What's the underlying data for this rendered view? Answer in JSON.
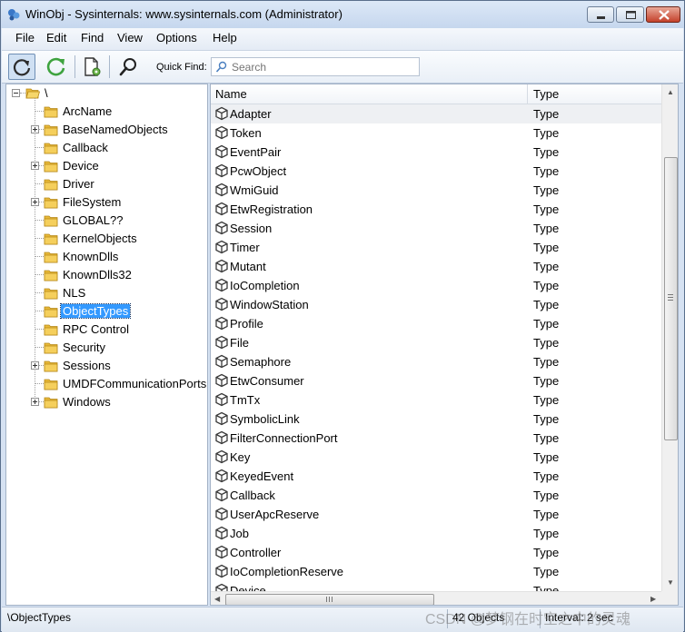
{
  "window": {
    "title": "WinObj - Sysinternals: www.sysinternals.com (Administrator)"
  },
  "menu": [
    "File",
    "Edit",
    "Find",
    "View",
    "Options",
    "Help"
  ],
  "toolbar": {
    "quick_find_label": "Quick Find:",
    "search_placeholder": "Search"
  },
  "tree": {
    "root": "\\",
    "items": [
      {
        "label": "ArcName",
        "expandable": false
      },
      {
        "label": "BaseNamedObjects",
        "expandable": true
      },
      {
        "label": "Callback",
        "expandable": false
      },
      {
        "label": "Device",
        "expandable": true
      },
      {
        "label": "Driver",
        "expandable": false
      },
      {
        "label": "FileSystem",
        "expandable": true
      },
      {
        "label": "GLOBAL??",
        "expandable": false
      },
      {
        "label": "KernelObjects",
        "expandable": false
      },
      {
        "label": "KnownDlls",
        "expandable": false
      },
      {
        "label": "KnownDlls32",
        "expandable": false
      },
      {
        "label": "NLS",
        "expandable": false
      },
      {
        "label": "ObjectTypes",
        "expandable": false,
        "selected": true
      },
      {
        "label": "RPC Control",
        "expandable": false
      },
      {
        "label": "Security",
        "expandable": false
      },
      {
        "label": "Sessions",
        "expandable": true
      },
      {
        "label": "UMDFCommunicationPorts",
        "expandable": false
      },
      {
        "label": "Windows",
        "expandable": true
      }
    ]
  },
  "list": {
    "columns": {
      "name": "Name",
      "type": "Type"
    },
    "rows": [
      {
        "name": "Adapter",
        "type": "Type"
      },
      {
        "name": "Token",
        "type": "Type"
      },
      {
        "name": "EventPair",
        "type": "Type"
      },
      {
        "name": "PcwObject",
        "type": "Type"
      },
      {
        "name": "WmiGuid",
        "type": "Type"
      },
      {
        "name": "EtwRegistration",
        "type": "Type"
      },
      {
        "name": "Session",
        "type": "Type"
      },
      {
        "name": "Timer",
        "type": "Type"
      },
      {
        "name": "Mutant",
        "type": "Type"
      },
      {
        "name": "IoCompletion",
        "type": "Type"
      },
      {
        "name": "WindowStation",
        "type": "Type"
      },
      {
        "name": "Profile",
        "type": "Type"
      },
      {
        "name": "File",
        "type": "Type"
      },
      {
        "name": "Semaphore",
        "type": "Type"
      },
      {
        "name": "EtwConsumer",
        "type": "Type"
      },
      {
        "name": "TmTx",
        "type": "Type"
      },
      {
        "name": "SymbolicLink",
        "type": "Type"
      },
      {
        "name": "FilterConnectionPort",
        "type": "Type"
      },
      {
        "name": "Key",
        "type": "Type"
      },
      {
        "name": "KeyedEvent",
        "type": "Type"
      },
      {
        "name": "Callback",
        "type": "Type"
      },
      {
        "name": "UserApcReserve",
        "type": "Type"
      },
      {
        "name": "Job",
        "type": "Type"
      },
      {
        "name": "Controller",
        "type": "Type"
      },
      {
        "name": "IoCompletionReserve",
        "type": "Type"
      },
      {
        "name": "Device",
        "type": "Type"
      }
    ]
  },
  "status": {
    "path": "\\ObjectTypes",
    "count": "42 Objects",
    "interval": "Interval: 2 sec"
  },
  "watermark": "CSDN @梦钢在时空之中的灵魂",
  "colors": {
    "selection": "#3399ff",
    "titlebar": "#c6d7ee",
    "close_button": "#c4412b"
  },
  "icons": [
    "winobj-app-icon",
    "refresh-icon",
    "auto-refresh-icon",
    "properties-icon",
    "find-icon",
    "search-icon",
    "folder-icon",
    "object-type-icon"
  ]
}
